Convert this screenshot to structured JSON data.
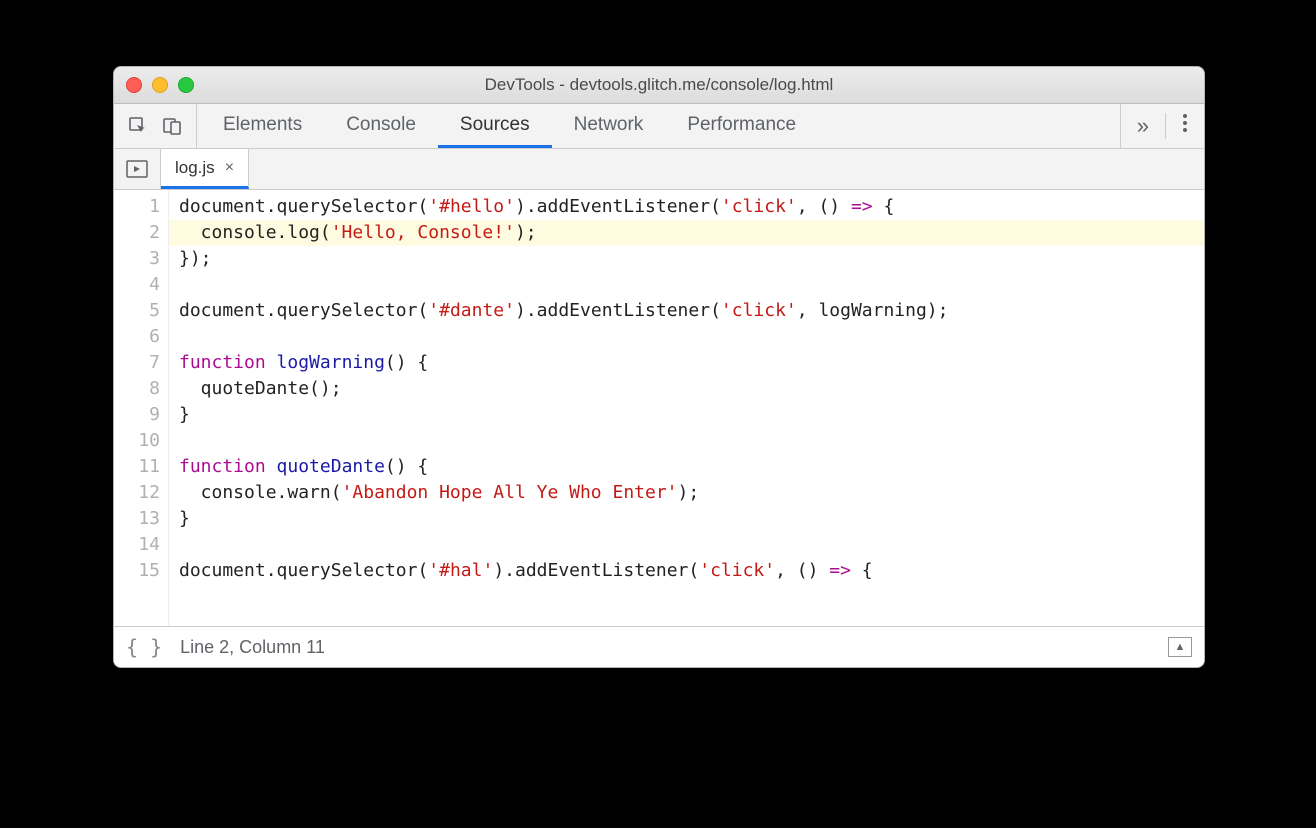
{
  "window": {
    "title": "DevTools - devtools.glitch.me/console/log.html"
  },
  "tabs": {
    "items": [
      "Elements",
      "Console",
      "Sources",
      "Network",
      "Performance"
    ],
    "active": "Sources",
    "overflow_glyph": "»"
  },
  "file_tab": {
    "name": "log.js",
    "close_glyph": "×"
  },
  "code": {
    "highlighted_line": 2,
    "lines": [
      [
        {
          "t": "document",
          "c": "pl"
        },
        {
          "t": ".",
          "c": "pl"
        },
        {
          "t": "querySelector",
          "c": "pl"
        },
        {
          "t": "(",
          "c": "pl"
        },
        {
          "t": "'#hello'",
          "c": "str"
        },
        {
          "t": ").",
          "c": "pl"
        },
        {
          "t": "addEventListener",
          "c": "pl"
        },
        {
          "t": "(",
          "c": "pl"
        },
        {
          "t": "'click'",
          "c": "str"
        },
        {
          "t": ", () ",
          "c": "pl"
        },
        {
          "t": "=>",
          "c": "kw"
        },
        {
          "t": " {",
          "c": "pl"
        }
      ],
      [
        {
          "t": "  console.log(",
          "c": "pl"
        },
        {
          "t": "'Hello, Console!'",
          "c": "str"
        },
        {
          "t": ");",
          "c": "pl"
        }
      ],
      [
        {
          "t": "});",
          "c": "pl"
        }
      ],
      [],
      [
        {
          "t": "document",
          "c": "pl"
        },
        {
          "t": ".",
          "c": "pl"
        },
        {
          "t": "querySelector",
          "c": "pl"
        },
        {
          "t": "(",
          "c": "pl"
        },
        {
          "t": "'#dante'",
          "c": "str"
        },
        {
          "t": ").",
          "c": "pl"
        },
        {
          "t": "addEventListener",
          "c": "pl"
        },
        {
          "t": "(",
          "c": "pl"
        },
        {
          "t": "'click'",
          "c": "str"
        },
        {
          "t": ", logWarning);",
          "c": "pl"
        }
      ],
      [],
      [
        {
          "t": "function ",
          "c": "kw"
        },
        {
          "t": "logWarning",
          "c": "fn"
        },
        {
          "t": "() {",
          "c": "pl"
        }
      ],
      [
        {
          "t": "  quoteDante();",
          "c": "pl"
        }
      ],
      [
        {
          "t": "}",
          "c": "pl"
        }
      ],
      [],
      [
        {
          "t": "function ",
          "c": "kw"
        },
        {
          "t": "quoteDante",
          "c": "fn"
        },
        {
          "t": "() {",
          "c": "pl"
        }
      ],
      [
        {
          "t": "  console.warn(",
          "c": "pl"
        },
        {
          "t": "'Abandon Hope All Ye Who Enter'",
          "c": "str"
        },
        {
          "t": ");",
          "c": "pl"
        }
      ],
      [
        {
          "t": "}",
          "c": "pl"
        }
      ],
      [],
      [
        {
          "t": "document",
          "c": "pl"
        },
        {
          "t": ".",
          "c": "pl"
        },
        {
          "t": "querySelector",
          "c": "pl"
        },
        {
          "t": "(",
          "c": "pl"
        },
        {
          "t": "'#hal'",
          "c": "str"
        },
        {
          "t": ").",
          "c": "pl"
        },
        {
          "t": "addEventListener",
          "c": "pl"
        },
        {
          "t": "(",
          "c": "pl"
        },
        {
          "t": "'click'",
          "c": "str"
        },
        {
          "t": ", () ",
          "c": "pl"
        },
        {
          "t": "=>",
          "c": "kw"
        },
        {
          "t": " {",
          "c": "pl"
        }
      ]
    ]
  },
  "status": {
    "pretty_print_glyph": "{ }",
    "position": "Line 2, Column 11",
    "drawer_glyph": "▲"
  }
}
